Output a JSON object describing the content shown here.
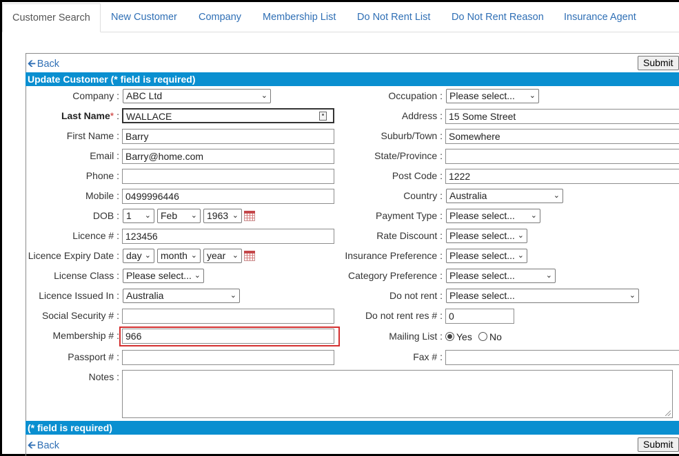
{
  "tabs": [
    "Customer Search",
    "New Customer",
    "Company",
    "Membership List",
    "Do Not Rent List",
    "Do Not Rent Reason",
    "Insurance Agent"
  ],
  "back_label": "Back",
  "submit_label": "Submit",
  "header_text": "Update Customer (* field is required)",
  "footer_text": "(* field is required)",
  "left": {
    "company": {
      "label": "Company :",
      "value": "ABC Ltd"
    },
    "last_name": {
      "label": "Last Name",
      "req": "*",
      "colon": " :",
      "value": "WALLACE"
    },
    "first_name": {
      "label": "First Name :",
      "value": "Barry"
    },
    "email": {
      "label": "Email :",
      "value": "Barry@home.com"
    },
    "phone": {
      "label": "Phone :",
      "value": ""
    },
    "mobile": {
      "label": "Mobile :",
      "value": "0499996446"
    },
    "dob": {
      "label": "DOB :",
      "day": "1",
      "month": "Feb",
      "year": "1963"
    },
    "licence": {
      "label": "Licence # :",
      "value": "123456"
    },
    "licence_expiry": {
      "label": "Licence Expiry Date :",
      "day": "day",
      "month": "month",
      "year": "year"
    },
    "license_class": {
      "label": "License Class :",
      "value": "Please select..."
    },
    "licence_issued": {
      "label": "Licence Issued In :",
      "value": "Australia"
    },
    "social_security": {
      "label": "Social Security # :",
      "value": ""
    },
    "membership": {
      "label": "Membership # :",
      "value": "966"
    },
    "passport": {
      "label": "Passport # :",
      "value": ""
    },
    "notes": {
      "label": "Notes :",
      "value": ""
    }
  },
  "right": {
    "occupation": {
      "label": "Occupation :",
      "value": "Please select..."
    },
    "address": {
      "label": "Address :",
      "value": "15 Some Street"
    },
    "suburb": {
      "label": "Suburb/Town :",
      "value": "Somewhere"
    },
    "state": {
      "label": "State/Province :",
      "value": ""
    },
    "postcode": {
      "label": "Post Code :",
      "value": "1222"
    },
    "country": {
      "label": "Country :",
      "value": "Australia"
    },
    "payment_type": {
      "label": "Payment Type :",
      "value": "Please select..."
    },
    "rate_discount": {
      "label": "Rate Discount :",
      "value": "Please select..."
    },
    "insurance_pref": {
      "label": "Insurance Preference :",
      "value": "Please select..."
    },
    "category_pref": {
      "label": "Category Preference :",
      "value": "Please select..."
    },
    "do_not_rent": {
      "label": "Do not rent :",
      "value": "Please select..."
    },
    "do_not_rent_res": {
      "label": "Do not rent res # :",
      "value": "0"
    },
    "mailing_list": {
      "label": "Mailing List :",
      "yes": "Yes",
      "no": "No",
      "selected": "Yes"
    },
    "fax": {
      "label": "Fax # :",
      "value": ""
    }
  },
  "colors": {
    "accent": "#0a8fd0",
    "link": "#2f6fb5",
    "highlight": "#d32f2f",
    "required": "#c9302c"
  },
  "icons": [
    "arrow-left-icon",
    "calendar-icon",
    "contact-card-icon",
    "chevron-down-icon",
    "resize-grip-icon"
  ]
}
